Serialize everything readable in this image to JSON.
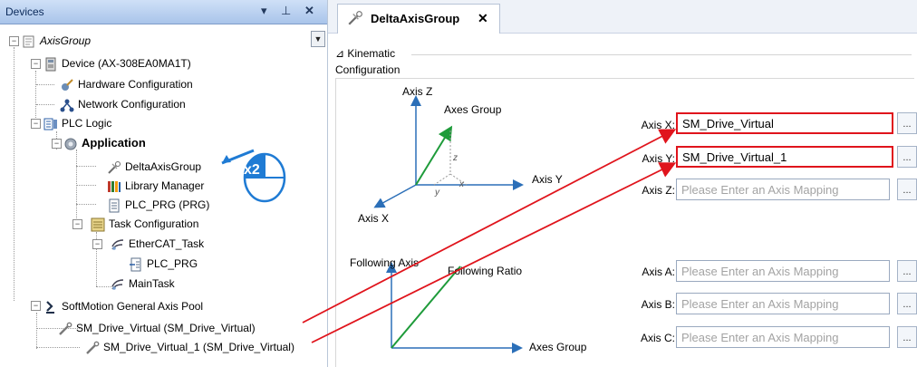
{
  "devices_panel": {
    "title": "Devices",
    "pin": " ↓",
    "pin_glyph": "ⷈ",
    "close": "✕",
    "dropdown": "▼"
  },
  "tree": {
    "axis_group": "AxisGroup",
    "device": "Device (AX-308EA0MA1T)",
    "hardware_configuration": "Hardware Configuration",
    "network_configuration": "Network Configuration",
    "plc_logic": "PLC Logic",
    "application": "Application",
    "delta_axis_group": "DeltaAxisGroup",
    "library_manager": "Library Manager",
    "plc_prg": "PLC_PRG (PRG)",
    "task_configuration": "Task Configuration",
    "ethercat_task": "EtherCAT_Task",
    "plc_prg_call": "PLC_PRG",
    "main_task": "MainTask",
    "softmotion_pool": "SoftMotion General Axis Pool",
    "sm_drive_virtual": "SM_Drive_Virtual (SM_Drive_Virtual)",
    "sm_drive_virtual_1": "SM_Drive_Virtual_1 (SM_Drive_Virtual)"
  },
  "double_click_badge": "x2",
  "editor": {
    "tab_title": "DeltaAxisGroup",
    "tab_close": "✕",
    "kinematic": "Kinematic",
    "configuration": "Configuration",
    "diagram": {
      "axis_z": "Axis Z",
      "axes_group": "Axes Group",
      "axis_y": "Axis Y",
      "axis_x": "Axis X",
      "z": "z",
      "x": "x",
      "y": "y",
      "following_axis": "Following Axis",
      "following_ratio": "Following Ratio",
      "axes_group_bottom": "Axes Group"
    },
    "axes": [
      {
        "label": "Axis X:",
        "value": "SM_Drive_Virtual",
        "placeholder": ""
      },
      {
        "label": "Axis Y:",
        "value": "SM_Drive_Virtual_1",
        "placeholder": ""
      },
      {
        "label": "Axis Z:",
        "value": "",
        "placeholder": "Please Enter an Axis Mapping"
      },
      {
        "label": "Axis A:",
        "value": "",
        "placeholder": "Please Enter an Axis Mapping"
      },
      {
        "label": "Axis B:",
        "value": "",
        "placeholder": "Please Enter an Axis Mapping"
      },
      {
        "label": "Axis C:",
        "value": "",
        "placeholder": "Please Enter an Axis Mapping"
      }
    ],
    "dots_label": "..."
  },
  "colors": {
    "highlight": "#e0141c",
    "axis_arrow": "#2b6fb8",
    "vector": "#1e9b3a",
    "badge": "#1f7bd4"
  }
}
